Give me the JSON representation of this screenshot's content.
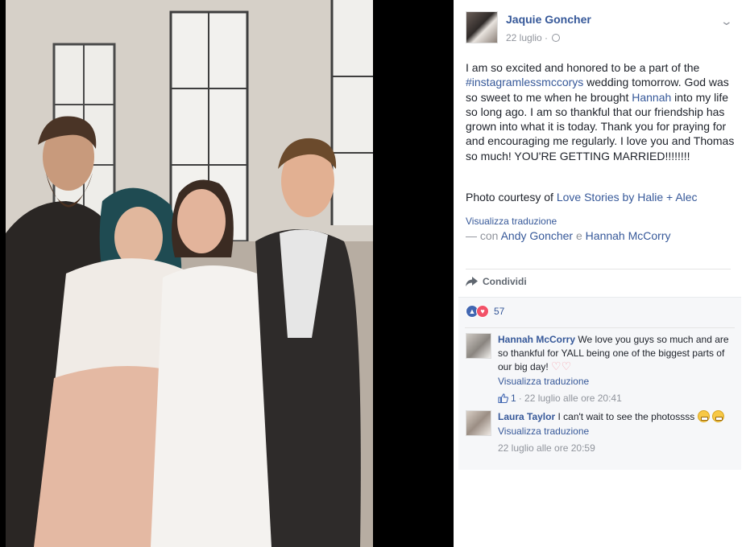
{
  "post": {
    "author": "Jaquie Goncher",
    "date": "22 luglio",
    "separator": "·",
    "text_1": "I am so excited and honored to be a part of the ",
    "hashtag": "#instagramlessmccorys",
    "text_2": " wedding tomorrow. God was so sweet to me when he brought ",
    "mention": "Hannah",
    "text_3": " into my life so long ago. I am so thankful that our friendship has grown into what it is today. Thank you for praying for and encouraging me regularly. I love you and Thomas so much! YOU'RE GETTING MARRIED!!!!!!!!",
    "credit_prefix": "Photo courtesy of ",
    "credit_link": "Love Stories by Halie + Alec",
    "translate": "Visualizza traduzione",
    "with_prefix": "— con ",
    "with_person_1": "Andy Goncher",
    "with_and": " e ",
    "with_person_2": "Hannah McCorry"
  },
  "actions": {
    "share": "Condividi"
  },
  "reactions": {
    "count": "57"
  },
  "comments": [
    {
      "author": "Hannah McCorry",
      "text": " We love you guys so much and are so thankful for YALL being one of the biggest parts of our big day! ",
      "translate": "Visualizza traduzione",
      "likes": "1",
      "time": "· 22 luglio alle ore 20:41"
    },
    {
      "author": "Laura Taylor",
      "text": " I can't wait to see the photossss ",
      "translate": "Visualizza traduzione",
      "time": "22 luglio alle ore 20:59"
    }
  ],
  "icons": {
    "globe": "globe-icon",
    "chevron": "chevron-down-icon",
    "share": "share-arrow-icon",
    "like": "like-reaction-icon",
    "love": "love-reaction-icon"
  },
  "colors": {
    "link": "#365899",
    "meta": "#90949c",
    "text": "#1d2129",
    "like": "#4267b2",
    "love": "#f25268"
  }
}
